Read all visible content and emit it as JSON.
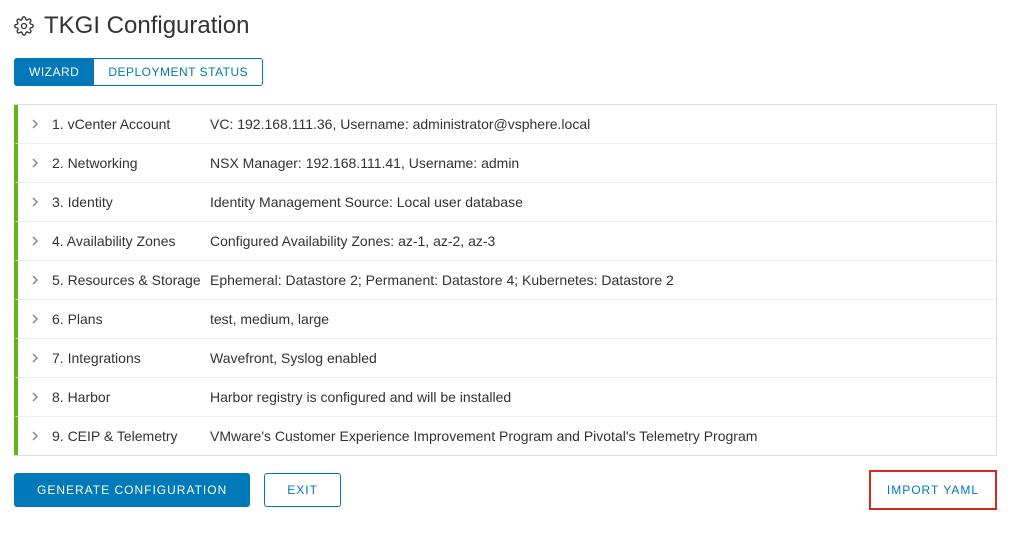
{
  "header": {
    "title": "TKGI Configuration"
  },
  "tabs": [
    {
      "label": "WIZARD",
      "active": true
    },
    {
      "label": "DEPLOYMENT STATUS",
      "active": false
    }
  ],
  "steps": [
    {
      "title": "1. vCenter Account",
      "desc": "VC: 192.168.111.36, Username: administrator@vsphere.local"
    },
    {
      "title": "2. Networking",
      "desc": "NSX Manager: 192.168.111.41, Username: admin"
    },
    {
      "title": "3. Identity",
      "desc": "Identity Management Source: Local user database"
    },
    {
      "title": "4. Availability Zones",
      "desc": "Configured Availability Zones: az-1, az-2, az-3"
    },
    {
      "title": "5. Resources & Storage",
      "desc": "Ephemeral: Datastore 2; Permanent: Datastore 4; Kubernetes: Datastore 2"
    },
    {
      "title": "6. Plans",
      "desc": "test, medium, large"
    },
    {
      "title": "7. Integrations",
      "desc": "Wavefront, Syslog enabled"
    },
    {
      "title": "8. Harbor",
      "desc": "Harbor registry is configured and will be installed"
    },
    {
      "title": "9. CEIP & Telemetry",
      "desc": "VMware's Customer Experience Improvement Program and Pivotal's Telemetry Program"
    }
  ],
  "footer": {
    "generate": "GENERATE CONFIGURATION",
    "exit": "EXIT",
    "import": "IMPORT YAML"
  },
  "colors": {
    "accent": "#0079b8",
    "success": "#5eb715",
    "highlight": "#d9281c"
  }
}
